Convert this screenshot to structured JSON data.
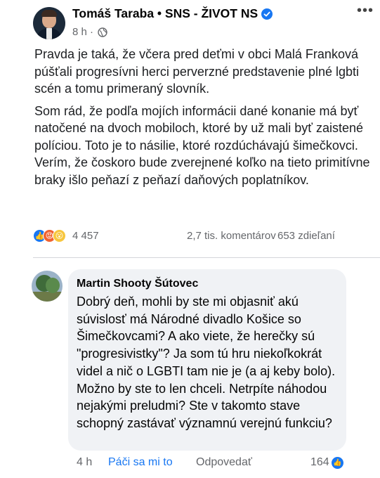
{
  "post": {
    "author": "Tomáš Taraba • SNS - ŽIVOT NS",
    "time": "8 h ·",
    "paragraphs": [
      "Pravda je taká, že včera pred deťmi v obci Malá Franková púšťali progresívni herci perverzné predstavenie plné lgbti scén a tomu primeraný slovník.",
      "Som rád, že podľa mojích informácii dané konanie má byť natočené na dvoch mobiloch, ktoré  by už mali byť zaistené políciou. Toto je to násilie, ktoré rozdúchávajú šimečkovci. Verím, že čoskoro bude zverejnené koľko na tieto primitívne braky išlo peňazí z peňazí daňových poplatníkov."
    ],
    "reaction_count": "4 457",
    "comments_count": "2,7 tis. komentárov",
    "shares_count": "653 zdieľaní",
    "icons": {
      "verified": "verified-badge-icon",
      "privacy": "globe-icon",
      "more": "more-options-icon",
      "reactions": [
        "like-icon",
        "angry-icon",
        "wow-icon"
      ]
    },
    "colors": {
      "verified": "#1877f2",
      "like": "#1877f2",
      "angry": "#f06230",
      "wow": "#f7c63e"
    }
  },
  "comment": {
    "author": "Martin Shooty Šútovec",
    "text": "Dobrý deň, mohli by ste mi objasniť akú súvislosť má Národné divadlo Košice so Šimečkovcami? A ako viete, že herečky sú \"progresivistky\"? Ja som tú hru niekoľkokrát videl a nič o LGBTI tam nie je (a aj keby bolo). Možno by ste to len chceli. Netrpíte náhodou nejakými preludmi? Ste v takomto stave schopný zastávať významnú verejnú funkciu?",
    "time": "4 h",
    "like_label": "Páči sa mi to",
    "reply_label": "Odpovedať",
    "like_count": "164"
  }
}
